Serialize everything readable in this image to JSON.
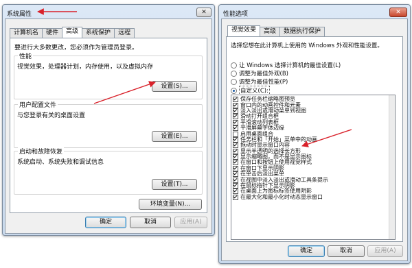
{
  "left": {
    "title": "系统属性",
    "close": "✕",
    "tabs": [
      "计算机名",
      "硬件",
      "高级",
      "系统保护",
      "远程"
    ],
    "admin_note": "要进行大多数更改，您必须作为管理员登录。",
    "performance": {
      "title": "性能",
      "desc": "视觉效果，处理器计划，内存使用，以及虚拟内存",
      "button": "设置(S)..."
    },
    "profiles": {
      "title": "用户配置文件",
      "desc": "与您登录有关的桌面设置",
      "button": "设置(E)..."
    },
    "startup": {
      "title": "启动和故障恢复",
      "desc": "系统启动、系统失败和调试信息",
      "button": "设置(T)..."
    },
    "env_button": "环境变量(N)...",
    "ok": "确定",
    "cancel": "取消",
    "apply": "应用(A)"
  },
  "right": {
    "title": "性能选项",
    "close": "✕",
    "tabs": [
      "视觉效果",
      "高级",
      "数据执行保护"
    ],
    "prompt": "选择您想在此计算机上使用的 Windows 外观和性能设置。",
    "radios": [
      {
        "label": "让 Windows 选择计算机的最佳设置(L)",
        "checked": false
      },
      {
        "label": "调整为最佳外观(B)",
        "checked": false
      },
      {
        "label": "调整为最佳性能(P)",
        "checked": false
      },
      {
        "label": "自定义(C):",
        "checked": true
      }
    ],
    "items": [
      {
        "label": "保存任务栏缩略图预览",
        "checked": true
      },
      {
        "label": "窗口内的动画控件和元素",
        "checked": true
      },
      {
        "label": "淡入淡出或滑动菜单到视图",
        "checked": true
      },
      {
        "label": "滑动打开组合框",
        "checked": true
      },
      {
        "label": "平滑滚动列表框",
        "checked": true
      },
      {
        "label": "平滑屏幕字体边缘",
        "checked": true
      },
      {
        "label": "启用桌面组合",
        "checked": false
      },
      {
        "label": "任务栏和「开始」菜单中的动画",
        "checked": true
      },
      {
        "label": "拖动时显示窗口内容",
        "checked": true
      },
      {
        "label": "显示半透明的选择长方形",
        "checked": true
      },
      {
        "label": "显示缩略图，而不是显示图标",
        "checked": true
      },
      {
        "label": "在窗口和按钮上使用视觉样式",
        "checked": true
      },
      {
        "label": "在窗口下显示阴影",
        "checked": true
      },
      {
        "label": "在单击后淡出菜单",
        "checked": true
      },
      {
        "label": "在视图中淡入淡出或滑动工具条提示",
        "checked": true
      },
      {
        "label": "在鼠标指针下显示阴影",
        "checked": true
      },
      {
        "label": "在桌面上为图标标签使用阴影",
        "checked": true
      },
      {
        "label": "在最大化和最小化时动态显示窗口",
        "checked": true
      }
    ],
    "ok": "确定",
    "cancel": "取消",
    "apply": "应用(A)"
  },
  "annotation_color": "#d9212a"
}
